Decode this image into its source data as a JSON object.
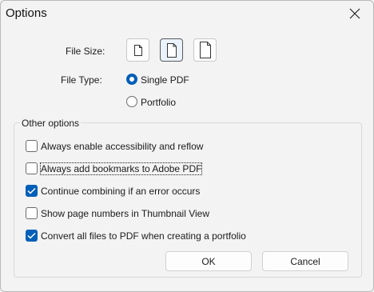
{
  "dialog": {
    "title": "Options",
    "file_size_label": "File Size:",
    "file_size_options": [
      "small-page-icon",
      "medium-page-icon",
      "large-page-icon"
    ],
    "file_size_selected_index": 1,
    "file_type_label": "File Type:",
    "file_type_options": [
      {
        "label": "Single PDF",
        "selected": true
      },
      {
        "label": "Portfolio",
        "selected": false
      }
    ],
    "other_options_title": "Other options",
    "options": [
      {
        "label": "Always enable accessibility and reflow",
        "checked": false
      },
      {
        "label": "Always add bookmarks to Adobe PDF",
        "checked": false
      },
      {
        "label": "Continue combining if an error occurs",
        "checked": true
      },
      {
        "label": "Show page numbers in Thumbnail View",
        "checked": false
      },
      {
        "label": "Convert all files to PDF when creating a portfolio",
        "checked": true
      }
    ],
    "ok_label": "OK",
    "cancel_label": "Cancel"
  },
  "colors": {
    "accent": "#005fb8",
    "background": "#f3f3f3"
  }
}
